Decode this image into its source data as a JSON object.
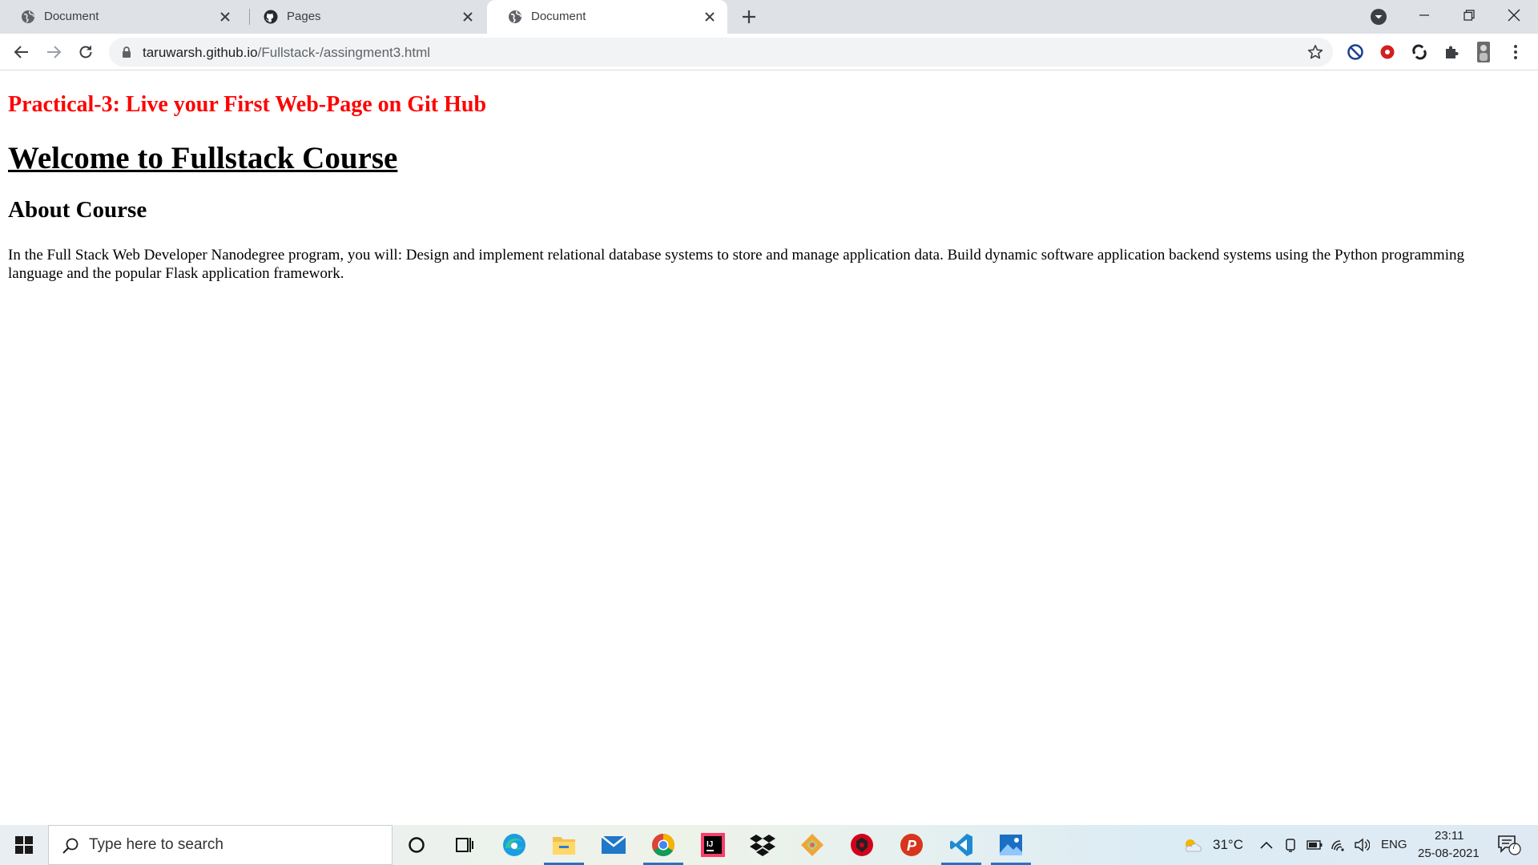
{
  "browser": {
    "tabs": [
      {
        "title": "Document",
        "active": false,
        "favicon": "globe-icon"
      },
      {
        "title": "Pages",
        "active": false,
        "favicon": "github-icon"
      },
      {
        "title": "Document",
        "active": true,
        "favicon": "globe-icon"
      }
    ],
    "url": {
      "host": "taruwarsh.github.io",
      "path": "/Fullstack-/assingment3.html"
    }
  },
  "page": {
    "practical_heading": "Practical-3: Live your First Web-Page on Git Hub",
    "welcome_heading": "Welcome to Fullstack Course",
    "about_heading": "About Course",
    "about_text": "In the Full Stack Web Developer Nanodegree program, you will: Design and implement relational database systems to store and manage application data. Build dynamic software application backend systems using the Python programming language and the popular Flask application framework."
  },
  "taskbar": {
    "search_placeholder": "Type here to search",
    "apps": [
      "cortana-icon",
      "task-view-icon",
      "edge-icon",
      "file-explorer-icon",
      "mail-icon",
      "chrome-icon",
      "intellij-icon",
      "dropbox-icon",
      "git-icon",
      "bitwarden-icon",
      "postman-icon",
      "vscode-icon",
      "photos-icon"
    ],
    "weather": "31°C",
    "language": "ENG",
    "time": "23:11",
    "date": "25-08-2021",
    "notifications_count": "7"
  },
  "colors": {
    "practical_heading": "#ff0000",
    "tabstrip_bg": "#dee1e6",
    "taskbar_accent": "#2e6fc2"
  }
}
